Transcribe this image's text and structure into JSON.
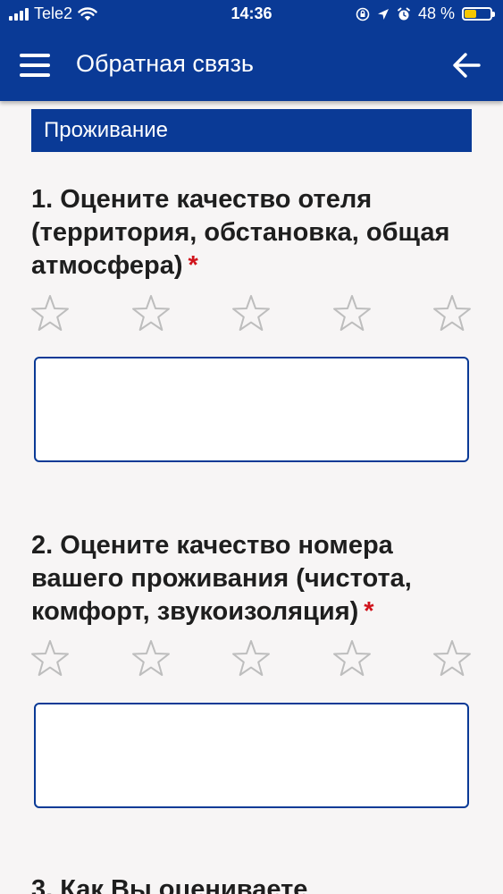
{
  "status_bar": {
    "carrier": "Tele2",
    "time": "14:36",
    "battery_percent": "48 %",
    "battery_level": 0.48,
    "icons": [
      "signal-icon",
      "wifi-icon",
      "rotation-lock-icon",
      "location-icon",
      "alarm-icon",
      "battery-icon"
    ]
  },
  "header": {
    "title": "Обратная связь",
    "menu_icon": "hamburger-menu-icon",
    "back_icon": "arrow-left-icon"
  },
  "section": {
    "title": "Проживание"
  },
  "questions": [
    {
      "text": "1. Оцените качество отеля (территория, обстановка, общая атмосфера)",
      "required_mark": "*",
      "rating": 0,
      "max_rating": 5,
      "comment_value": ""
    },
    {
      "text": "2. Оцените качество номера вашего проживания (чистота, комфорт, звукоизоляция)",
      "required_mark": "*",
      "rating": 0,
      "max_rating": 5,
      "comment_value": ""
    },
    {
      "text": "3. Как Вы оцениваете"
    }
  ],
  "colors": {
    "primary": "#0a3a96",
    "required": "#d0131b",
    "background": "#f7f5f5",
    "star_outline": "#bdbdbd"
  }
}
